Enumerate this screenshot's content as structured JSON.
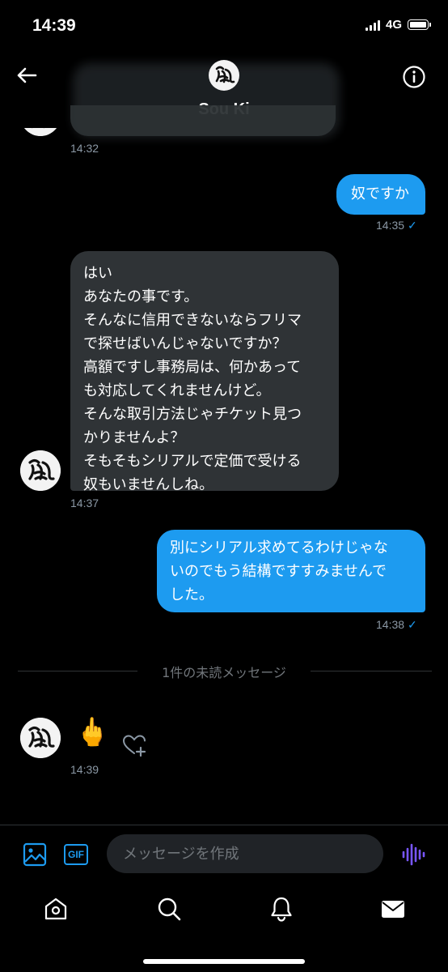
{
  "status_bar": {
    "time": "14:39",
    "network": "4G"
  },
  "header": {
    "contact_name": "Sou Ki"
  },
  "messages": [
    {
      "type": "received",
      "time": "14:32"
    },
    {
      "type": "sent",
      "lines": [
        "奴ですか"
      ],
      "time": "14:35"
    },
    {
      "type": "received",
      "lines": [
        "はい",
        "あなたの事です。",
        "そんなに信用できないならフリマ",
        "で探せばいんじゃないですか？",
        "高額ですし事務局は、何かあって",
        "も対応してくれませんけど。",
        "そんな取引方法じゃチケット見つ",
        "かりませんよ？",
        "そもそもシリアルで定価で受ける",
        "奴もいませんしね。"
      ],
      "time": "14:37"
    },
    {
      "type": "sent",
      "lines": [
        "別にシリアル求めてるわけじゃな",
        "いのでもう結構ですすみませんで",
        "した。"
      ],
      "time": "14:38"
    },
    {
      "type": "received",
      "emoji": "🖕",
      "time": "14:39"
    }
  ],
  "unread_divider": "1件の未読メッセージ",
  "read_check": "✓",
  "composer": {
    "placeholder": "メッセージを作成",
    "gif_label": "GIF"
  },
  "icons": [
    "back-arrow-icon",
    "info-icon",
    "image-icon",
    "gif-icon",
    "voice-icon",
    "heart-plus-icon",
    "home-icon",
    "search-icon",
    "bell-icon",
    "mail-icon"
  ],
  "colors": {
    "accent": "#1d9bf0",
    "received_bubble": "#2f3336",
    "voice_accent": "#7856ff",
    "background": "#000000"
  }
}
